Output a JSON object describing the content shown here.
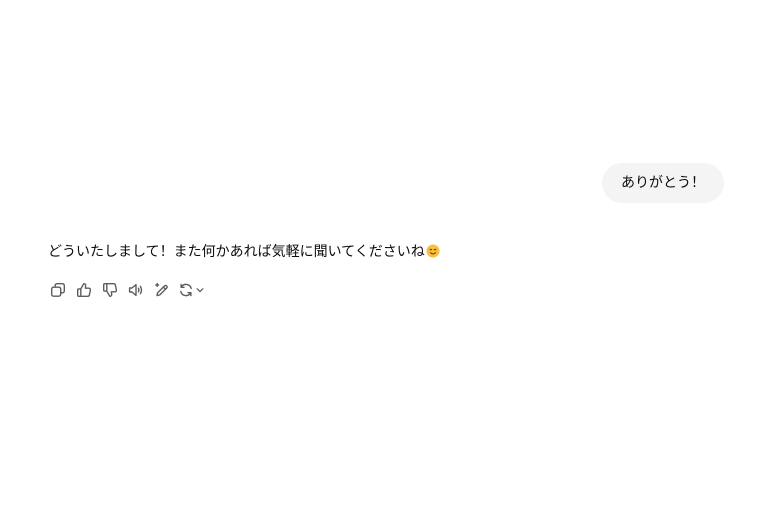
{
  "conversation": {
    "user_message": "ありがとう！",
    "assistant_message": "どういたしまして！また何かあれば気軽に聞いてくださいね",
    "assistant_emoji": "smiling-face-emoji"
  },
  "actions": [
    {
      "name": "copy",
      "icon": "copy-icon"
    },
    {
      "name": "good-response",
      "icon": "thumbs-up-icon"
    },
    {
      "name": "bad-response",
      "icon": "thumbs-down-icon"
    },
    {
      "name": "read-aloud",
      "icon": "speaker-icon"
    },
    {
      "name": "edit-in-canvas",
      "icon": "magic-pen-icon"
    },
    {
      "name": "regenerate",
      "icon": "refresh-icon"
    }
  ],
  "colors": {
    "user_bubble_bg": "#f4f4f4",
    "text": "#0d0d0d",
    "icon": "#5d5d5d",
    "emoji": "#f7c23a"
  }
}
